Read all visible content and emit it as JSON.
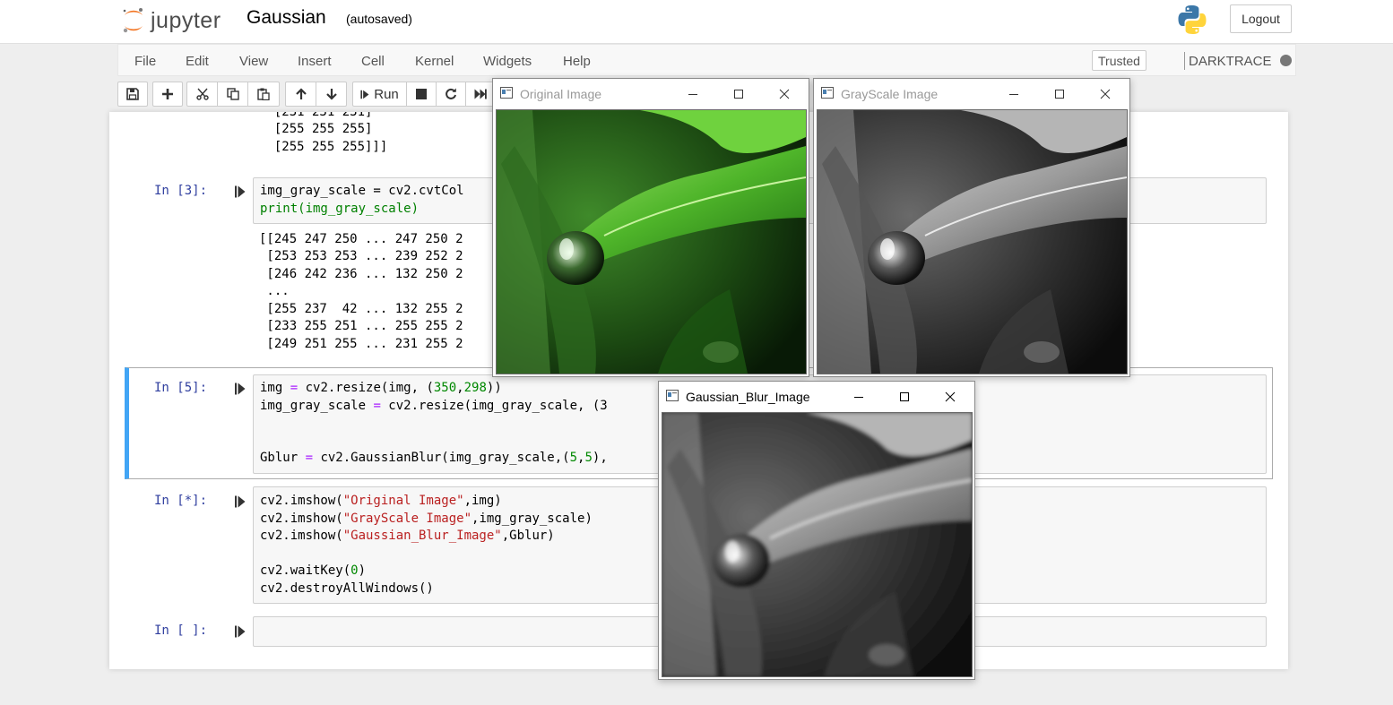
{
  "header": {
    "logo_text": "jupyter",
    "notebook_name": "Gaussian",
    "autosave_status": "(autosaved)",
    "logout_label": "Logout"
  },
  "menu": {
    "items": [
      "File",
      "Edit",
      "View",
      "Insert",
      "Cell",
      "Kernel",
      "Widgets",
      "Help"
    ],
    "trusted_label": "Trusted",
    "kernel_name": "DARKTRACE"
  },
  "toolbar": {
    "run_label": "Run",
    "icons": [
      "save-icon",
      "plus-icon",
      "cut-icon",
      "copy-icon",
      "paste-icon",
      "arrow-up-icon",
      "arrow-down-icon",
      "run-icon",
      "stop-icon",
      "restart-icon",
      "fast-forward-icon"
    ]
  },
  "cells": {
    "prev_output": [
      "  [231 231 231]",
      "  [255 255 255]",
      "  [255 255 255]]]"
    ],
    "cell3": {
      "prompt": "In [3]:",
      "code": [
        "img_gray_scale = cv2.cvtCol",
        "print(img_gray_scale)"
      ],
      "output": [
        "[[245 247 250 ... 247 250 2",
        " [253 253 253 ... 239 252 2",
        " [246 242 236 ... 132 250 2",
        " ...",
        " [255 237  42 ... 132 255 2",
        " [233 255 251 ... 255 255 2",
        " [249 251 255 ... 231 255 2"
      ]
    },
    "cell5": {
      "prompt": "In [5]:",
      "line1": {
        "a": "img ",
        "b": "=",
        "c": " cv2.resize(img, (",
        "d": "350",
        "e": ",",
        "f": "298",
        "g": "))"
      },
      "line2": {
        "a": "img_gray_scale ",
        "b": "=",
        "c": " cv2.resize(img_gray_scale, (3"
      },
      "line3": {
        "a": "Gblur ",
        "b": "=",
        "c": " cv2.GaussianBlur(img_gray_scale,(",
        "d": "5",
        "e": ",",
        "f": "5",
        "g": "),"
      }
    },
    "cell_star": {
      "prompt": "In [*]:",
      "line1": {
        "a": "cv2.imshow(",
        "b": "\"Original Image\"",
        "c": ",img)"
      },
      "line2": {
        "a": "cv2.imshow(",
        "b": "\"GrayScale Image\"",
        "c": ",img_gray_scale)"
      },
      "line3": {
        "a": "cv2.imshow(",
        "b": "\"Gaussian_Blur_Image\"",
        "c": ",Gblur)"
      },
      "line4": {
        "a": "cv2.waitKey(",
        "b": "0",
        "c": ")"
      },
      "line5": "cv2.destroyAllWindows()"
    },
    "cell_empty": {
      "prompt": "In [ ]:"
    }
  },
  "windows": {
    "original": {
      "title": "Original Image"
    },
    "grayscale": {
      "title": "GrayScale Image"
    },
    "blur": {
      "title": "Gaussian_Blur_Image"
    }
  }
}
